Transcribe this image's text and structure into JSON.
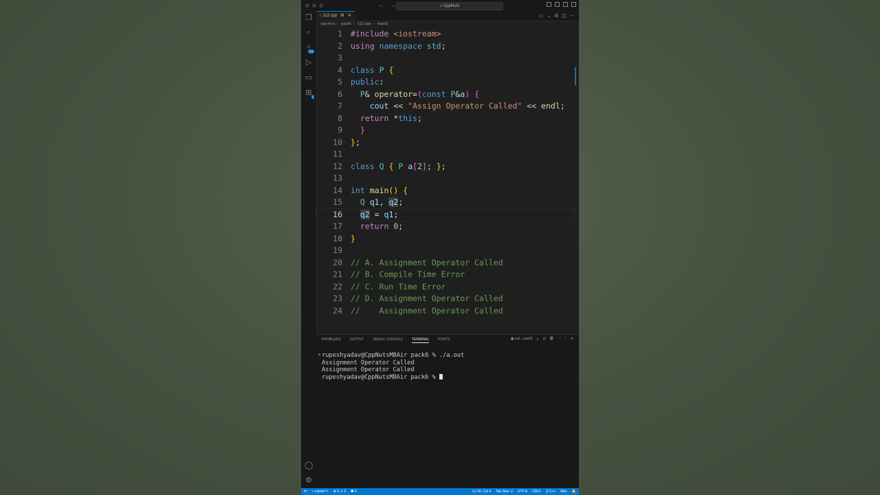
{
  "window": {
    "search": "CppNuts"
  },
  "tab": {
    "filename": "112.cpp",
    "status": "M"
  },
  "breadcrumb": [
    "cpp mcq",
    "pack6",
    "112.cpp",
    "main()"
  ],
  "code_lines": [
    {
      "n": "1",
      "html": "<span class='kw2'>#include</span> <span class='str'>&lt;iostream&gt;</span>"
    },
    {
      "n": "2",
      "html": "<span class='kw2'>using</span> <span class='kw'>namespace</span> <span class='ty'>std</span><span class='pn'>;</span>"
    },
    {
      "n": "3",
      "html": ""
    },
    {
      "n": "4",
      "html": "<span class='kw'>class</span> <span class='ty'>P</span> <span class='br1'>{</span>"
    },
    {
      "n": "5",
      "html": "<span class='kw'>public</span><span class='pn'>:</span>"
    },
    {
      "n": "6",
      "html": "  <span class='ty'>P</span><span class='pn'>&amp;</span> <span class='fn'>operator=</span><span class='br2'>(</span><span class='kw'>const</span> <span class='ty'>P</span><span class='pn'>&amp;</span><span class='id'>a</span><span class='br2'>)</span> <span class='br2'>{</span>"
    },
    {
      "n": "7",
      "html": "    <span class='id'>cout</span> <span class='pn'>&lt;&lt;</span> <span class='str'>\"Assign Operator Called\"</span> <span class='pn'>&lt;&lt;</span> <span class='fn'>endl</span><span class='pn'>;</span>"
    },
    {
      "n": "8",
      "html": "  <span class='kw2'>return</span> <span class='pn'>*</span><span class='kw'>this</span><span class='pn'>;</span>"
    },
    {
      "n": "9",
      "html": "  <span class='br2'>}</span>"
    },
    {
      "n": "10",
      "html": "<span class='br1'>}</span><span class='pn'>;</span>"
    },
    {
      "n": "11",
      "html": ""
    },
    {
      "n": "12",
      "html": "<span class='kw'>class</span> <span class='ty'>Q</span> <span class='br1'>{</span> <span class='ty'>P</span> <span class='id'>a</span><span class='br2'>[</span><span class='num'>2</span><span class='br2'>]</span><span class='pn'>;</span> <span class='br1'>}</span><span class='pn'>;</span>"
    },
    {
      "n": "13",
      "html": ""
    },
    {
      "n": "14",
      "html": "<span class='kw'>int</span> <span class='fn'>main</span><span class='br1'>()</span> <span class='br1'>{</span>"
    },
    {
      "n": "15",
      "html": "  <span class='ty'>Q</span> <span class='id'>q1</span><span class='pn'>,</span> <span class='id hl'>q2</span><span class='pn'>;</span>"
    },
    {
      "n": "16",
      "html": "  <span class='id hl'>q2</span> <span class='pn'>=</span> <span class='id'>q1</span><span class='pn'>;</span>"
    },
    {
      "n": "17",
      "html": "  <span class='kw2'>return</span> <span class='num'>0</span><span class='pn'>;</span>"
    },
    {
      "n": "18",
      "html": "<span class='br1'>}</span>"
    },
    {
      "n": "19",
      "html": ""
    },
    {
      "n": "20",
      "html": "<span class='cm'>// A. Assignment Operator Called</span>"
    },
    {
      "n": "21",
      "html": "<span class='cm'>// B. Compile Time Error</span>"
    },
    {
      "n": "22",
      "html": "<span class='cm'>// C. Run Time Error</span>"
    },
    {
      "n": "23",
      "html": "<span class='cm'>// D. Assignment Operator Called</span>"
    },
    {
      "n": "24",
      "html": "<span class='cm'>//    Assignment Operator Called</span>"
    }
  ],
  "panel": {
    "tabs": [
      "PROBLEMS",
      "OUTPUT",
      "DEBUG CONSOLE",
      "TERMINAL",
      "PORTS"
    ],
    "active_tab": "TERMINAL",
    "shell": "zsh - pack6"
  },
  "terminal": [
    "rupeshyadav@CppNutsMBAir pack6 % ./a.out",
    "Assignment Operator Called",
    "Assignment Operator Called",
    "rupeshyadav@CppNutsMBAir pack6 % "
  ],
  "status": {
    "branch": "master*+",
    "errors": "⊗ 0 ⚠ 0",
    "ports": "⚈ 0",
    "position": "Ln 16, Col 4",
    "tab_size": "Tab Size: 2",
    "encoding": "UTF-8",
    "eol": "CRLF",
    "language": "{} C++",
    "platform": "Mac"
  },
  "colors": {
    "accent": "#0078d4",
    "editor_bg": "#1f1f1f",
    "backdrop": "#4a5544"
  }
}
